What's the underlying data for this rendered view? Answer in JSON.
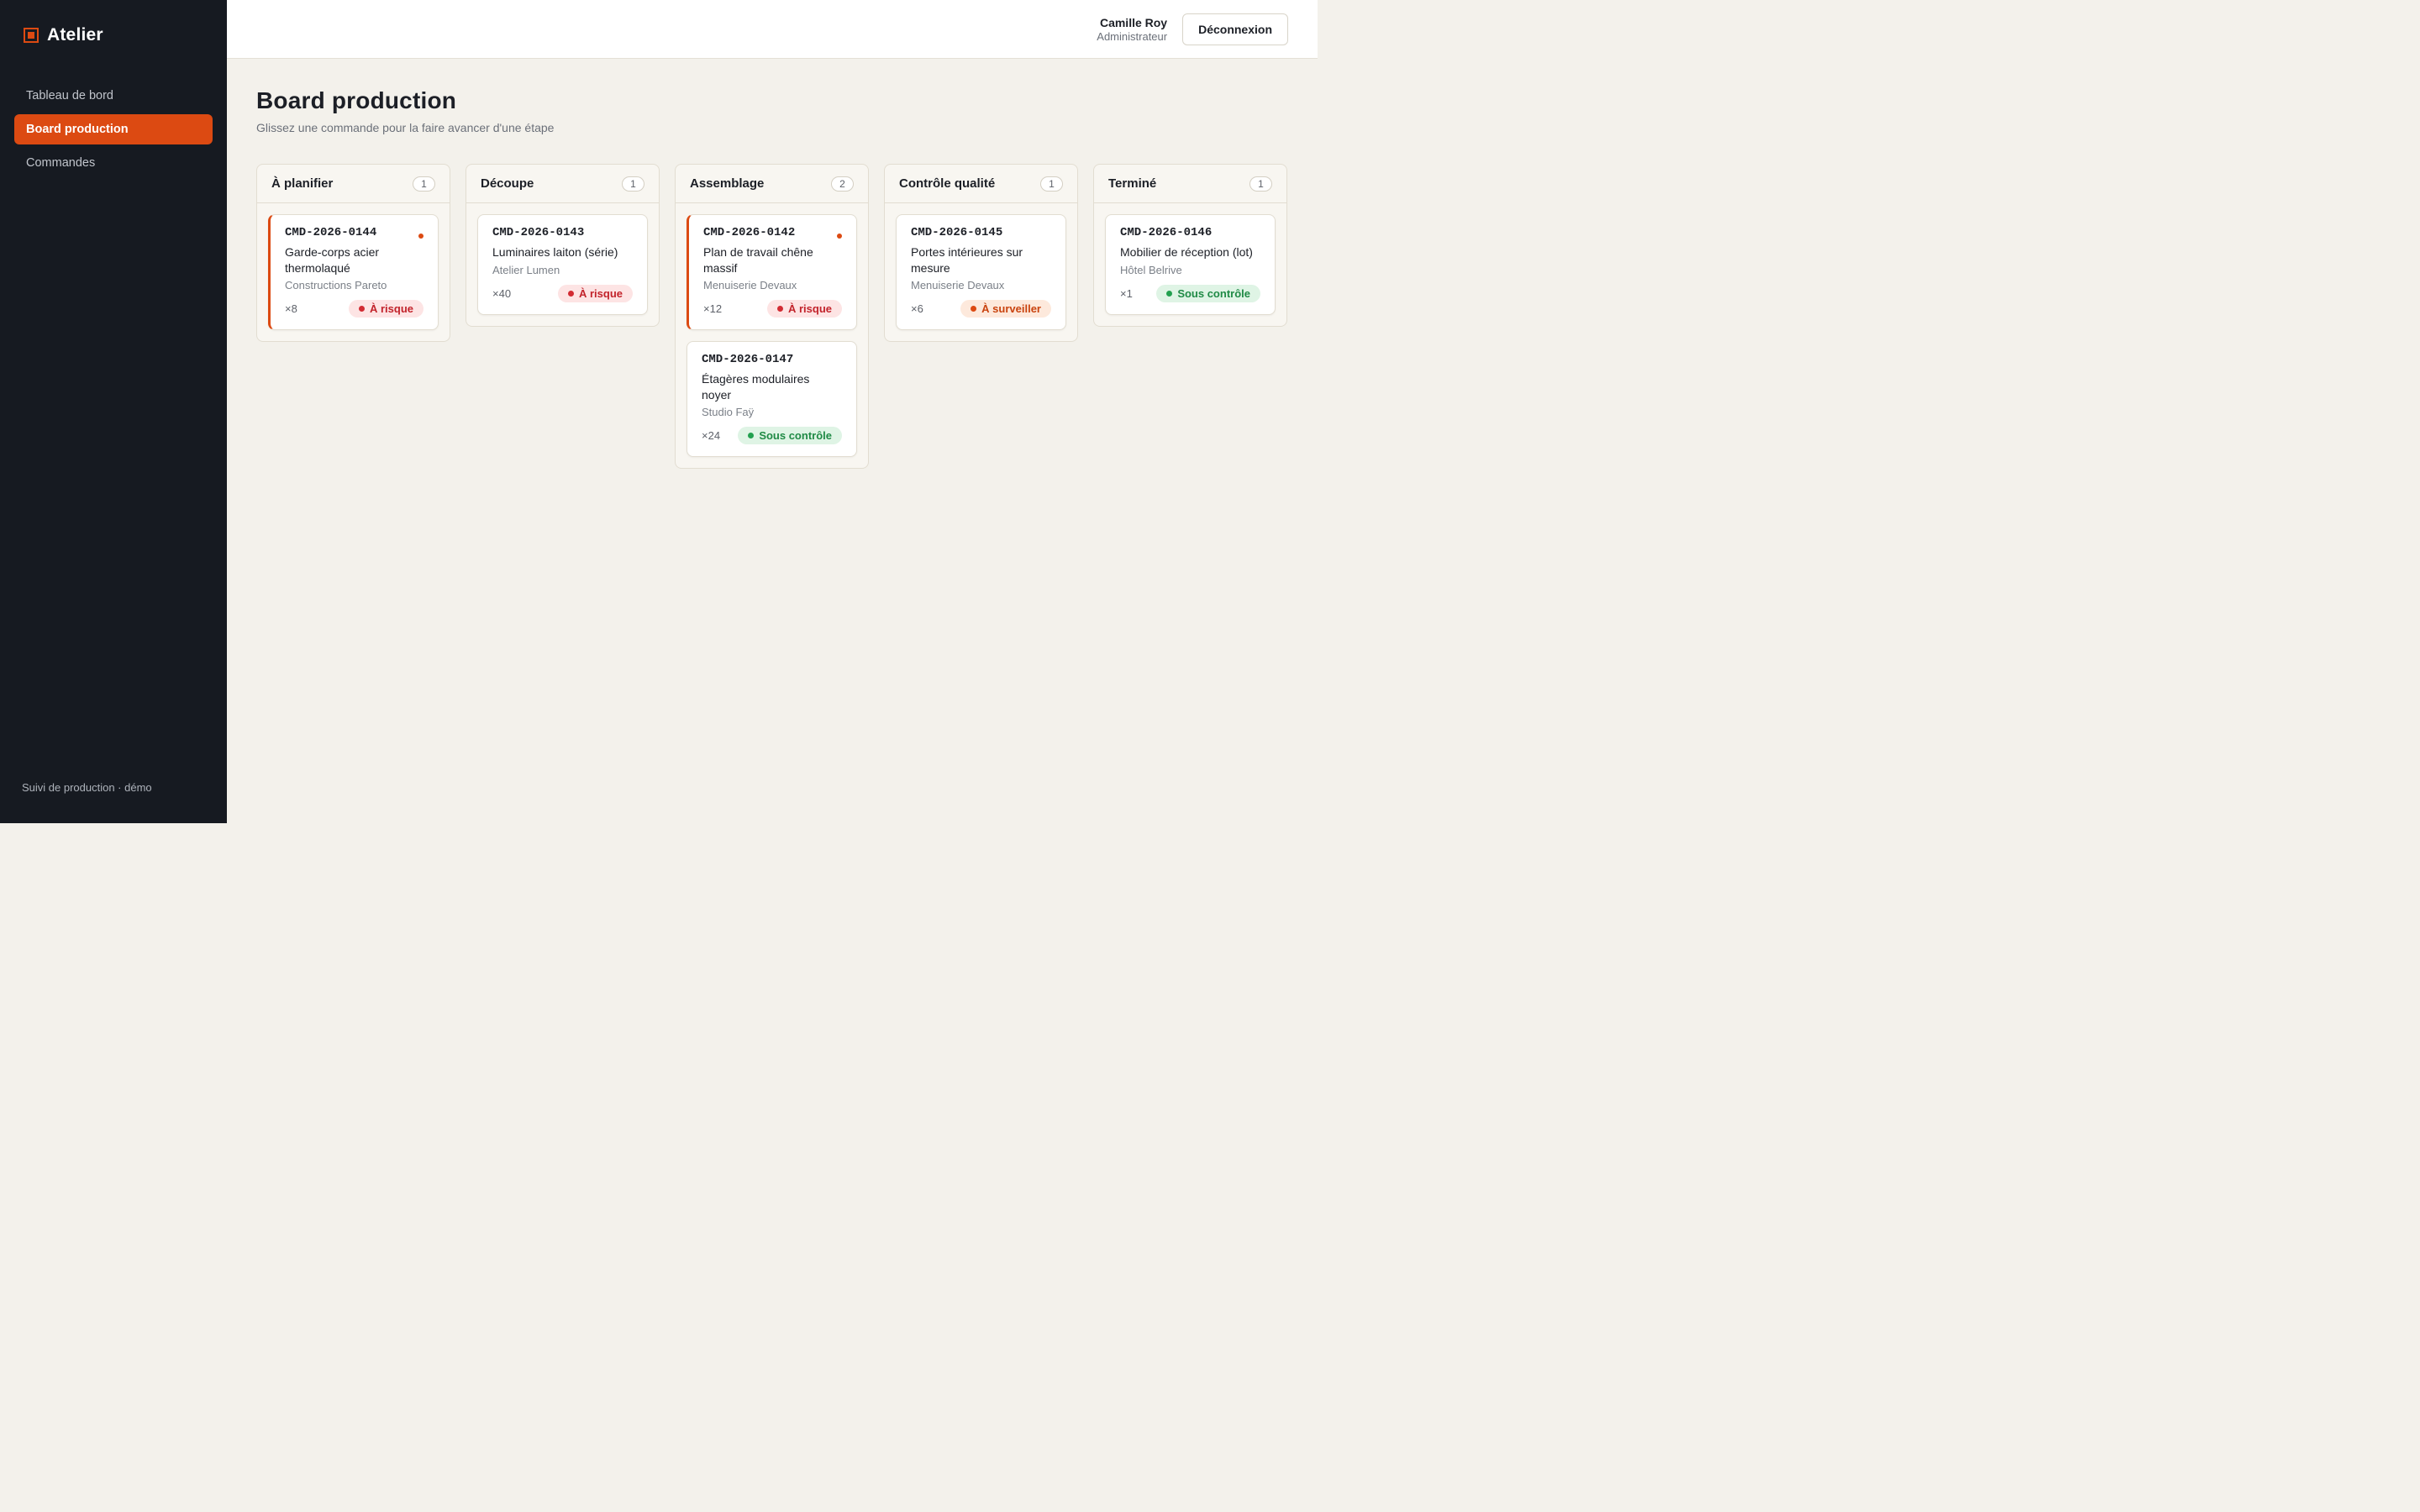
{
  "brand": {
    "name": "Atelier",
    "accent": "#dc4a12"
  },
  "sidebar": {
    "items": [
      {
        "label": "Tableau de bord",
        "active": false
      },
      {
        "label": "Board production",
        "active": true
      },
      {
        "label": "Commandes",
        "active": false
      }
    ],
    "footer": "Suivi de production · démo"
  },
  "topbar": {
    "user_name": "Camille Roy",
    "user_role": "Administrateur",
    "logout_label": "Déconnexion"
  },
  "page": {
    "title": "Board production",
    "subtitle": "Glissez une commande pour la faire avancer d'une étape"
  },
  "columns": [
    {
      "title": "À planifier",
      "count": "1",
      "cards": [
        {
          "id": "CMD-2026-0144",
          "title": "Garde-corps acier thermolaqué",
          "client": "Constructions Pareto",
          "qty": "×8",
          "status": "À risque",
          "status_type": "risk",
          "alert": true
        }
      ]
    },
    {
      "title": "Découpe",
      "count": "1",
      "cards": [
        {
          "id": "CMD-2026-0143",
          "title": "Luminaires laiton (série)",
          "client": "Atelier Lumen",
          "qty": "×40",
          "status": "À risque",
          "status_type": "risk",
          "alert": false
        }
      ]
    },
    {
      "title": "Assemblage",
      "count": "2",
      "cards": [
        {
          "id": "CMD-2026-0142",
          "title": "Plan de travail chêne massif",
          "client": "Menuiserie Devaux",
          "qty": "×12",
          "status": "À risque",
          "status_type": "risk",
          "alert": true
        },
        {
          "id": "CMD-2026-0147",
          "title": "Étagères modulaires noyer",
          "client": "Studio Faÿ",
          "qty": "×24",
          "status": "Sous contrôle",
          "status_type": "ok",
          "alert": false
        }
      ]
    },
    {
      "title": "Contrôle qualité",
      "count": "1",
      "cards": [
        {
          "id": "CMD-2026-0145",
          "title": "Portes intérieures sur mesure",
          "client": "Menuiserie Devaux",
          "qty": "×6",
          "status": "À surveiller",
          "status_type": "watch",
          "alert": false
        }
      ]
    },
    {
      "title": "Terminé",
      "count": "1",
      "cards": [
        {
          "id": "CMD-2026-0146",
          "title": "Mobilier de réception (lot)",
          "client": "Hôtel Belrive",
          "qty": "×1",
          "status": "Sous contrôle",
          "status_type": "ok",
          "alert": false
        }
      ]
    }
  ],
  "colors": {
    "risk": "#d22b33",
    "watch": "#dc4a12",
    "ok": "#22a04f",
    "sidebar_bg": "#161a21",
    "page_bg": "#f3f1eb"
  }
}
